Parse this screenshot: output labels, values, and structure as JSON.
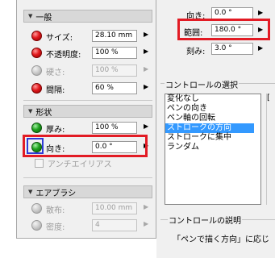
{
  "left_panel": {
    "sections": [
      {
        "title": "一般",
        "collapse_icon": "triangle-down-icon"
      },
      {
        "title": "形状",
        "collapse_icon": "triangle-down-icon"
      },
      {
        "title": "エアブラシ",
        "collapse_icon": "triangle-down-icon"
      }
    ],
    "general_rows": [
      {
        "label": "サイズ:",
        "value": "28.10 mm",
        "dot": "red",
        "enabled": true
      },
      {
        "label": "不透明度:",
        "value": "100 %",
        "dot": "red",
        "enabled": true
      },
      {
        "label": "硬さ:",
        "value": "100 %",
        "dot": "grey",
        "enabled": false
      },
      {
        "label": "間隔:",
        "value": "60 %",
        "dot": "red",
        "enabled": true
      }
    ],
    "shape_rows": [
      {
        "label": "厚み:",
        "value": "100 %",
        "dot": "green",
        "enabled": true
      },
      {
        "label": "向き:",
        "value": "0.0 °",
        "dot": "green",
        "enabled": true
      }
    ],
    "antialias_label": "アンチエイリアス",
    "airbrush_rows": [
      {
        "label": "散布:",
        "value": "10.00 mm",
        "dot": "grey",
        "enabled": false
      },
      {
        "label": "密度:",
        "value": "4",
        "dot": "grey",
        "enabled": false
      }
    ],
    "arrow_glyph": "▶",
    "collapse_glyph": "▼"
  },
  "right_panel": {
    "top_rows": [
      {
        "label": "向き:",
        "value": "0.0 °"
      },
      {
        "label": "範囲:",
        "value": "180.0 °"
      },
      {
        "label": "刻み:",
        "value": "3.0 °"
      }
    ],
    "control_select_title": "コントロールの選択",
    "control_options": [
      "変化なし",
      "ペンの向き",
      "ペン軸の回転",
      "ストロークの方向",
      "ストロークに集中",
      "ランダム"
    ],
    "selected_option": "ストロークの方向",
    "side_text": "[",
    "control_desc_title": "コントロールの説明",
    "control_desc_text": "「ペンで描く方向」に応じ"
  },
  "colors": {
    "highlight_red": "#e21b24",
    "highlight_blue": "#2f3bd6",
    "selection": "#3399ff"
  }
}
